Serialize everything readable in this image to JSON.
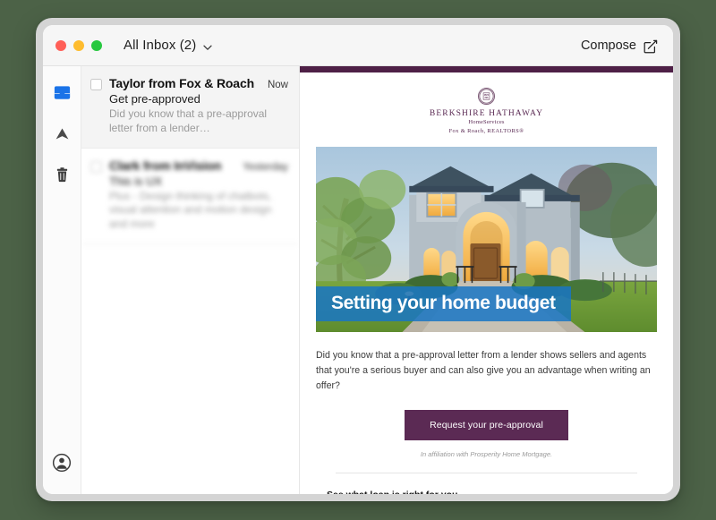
{
  "window": {
    "traffic_lights": [
      {
        "name": "close",
        "color": "#ff5f57"
      },
      {
        "name": "minimize",
        "color": "#febc2e"
      },
      {
        "name": "zoom",
        "color": "#28c840"
      }
    ],
    "background_color": "#4c6247",
    "bezel_color": "#d4d4d4"
  },
  "titlebar": {
    "mailbox_label": "All Inbox (2)",
    "mailbox_chevron_icon": "chevron-down-icon",
    "compose_label": "Compose",
    "compose_icon": "compose-pencil-square-icon"
  },
  "rail": {
    "items": [
      {
        "name": "inbox",
        "icon": "inbox-tray-icon",
        "active": true,
        "color": "#1a73e8"
      },
      {
        "name": "sent",
        "icon": "paper-plane-up-icon",
        "active": false,
        "color": "#4a4a4a"
      },
      {
        "name": "trash",
        "icon": "trash-can-icon",
        "active": false,
        "color": "#3d3d3d"
      }
    ],
    "account": {
      "name": "account",
      "icon": "user-circle-icon",
      "color": "#3d3d3d"
    }
  },
  "message_list": {
    "messages": [
      {
        "sender": "Taylor from Fox & Roach",
        "time": "Now",
        "subject": "Get pre-approved",
        "preview": "Did you know that a pre-approval letter from a lender…",
        "selected": true,
        "blurred": false,
        "checked": false
      },
      {
        "sender": "Clark from InVision",
        "time": "Yesterday",
        "subject": "This is UX",
        "preview": "Plus - Design thinking of chatbots, visual attention and motion design and more",
        "selected": false,
        "blurred": true,
        "checked": false
      }
    ]
  },
  "email": {
    "accent_bar_color": "#4e2046",
    "brand": {
      "monogram": "BH\nHS",
      "name": "BERKSHIRE HATHAWAY",
      "subtitle": "HomeServices",
      "office": "Fox & Roach, REALTORS®"
    },
    "hero": {
      "banner_text": "Setting your home budget",
      "banner_color": "#1976c4",
      "image_alt": "Two-story stucco home at dusk with warm lit windows, landscaped front yard and walkway"
    },
    "body_text": "Did you know that a pre-approval letter from a lender shows sellers and agents that you're a serious buyer and can also give you an advantage when writing an offer?",
    "cta_label": "Request your pre-approval",
    "cta_color": "#5b2a54",
    "affiliation_note": "In affiliation with Prosperity Home Mortgage.",
    "section_heading": "See what loan is right for you"
  }
}
